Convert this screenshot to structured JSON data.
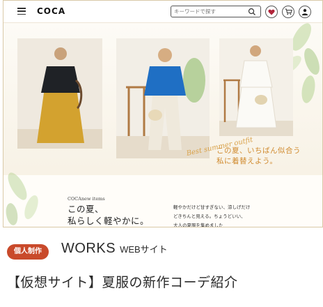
{
  "header": {
    "logo": "COCA",
    "search_placeholder": "キーワードで探す",
    "icons": [
      "menu-icon",
      "search-icon",
      "heart-icon",
      "cart-icon",
      "user-icon"
    ]
  },
  "hero": {
    "script_text": "Best summer outfit",
    "copy_line1": "この夏、いちばん似合う",
    "copy_line2": "私に着替えよう。"
  },
  "lower": {
    "label": "COCAnew items",
    "heading_line1": "この夏、",
    "heading_line2": "私らしく軽やかに。",
    "body_line1": "軽やかだけど甘すぎない、涼しげだけ",
    "body_line2": "どきちんと見える。ちょうどいい、",
    "body_line3": "大人の夏服を集めました"
  },
  "card": {
    "tag": "個人制作",
    "title": "WORKS",
    "title_sub": "WEBサイト",
    "description": "【仮想サイト】夏服の新作コーデ紹介"
  },
  "colors": {
    "accent": "#c94a2b",
    "hero_copy": "#d08a2e",
    "cart_heart": "#b0243a"
  }
}
